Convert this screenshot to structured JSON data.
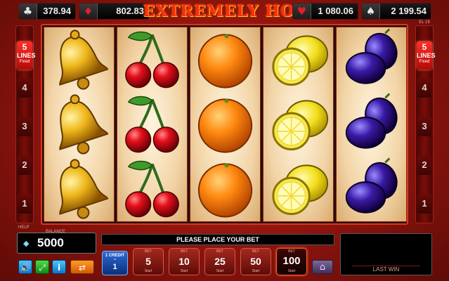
{
  "title": "EXTREMELY HOT",
  "jackpots": [
    {
      "suit_icon": "clubs-icon",
      "glyph": "♣",
      "color": "#e8e8e8",
      "amount": "378.94"
    },
    {
      "suit_icon": "diamonds-icon",
      "glyph": "♦",
      "color": "#e0202a",
      "amount": "802.83"
    },
    {
      "suit_icon": "hearts-icon",
      "glyph": "♥",
      "color": "#e0202a",
      "amount": "1 080.06"
    },
    {
      "suit_icon": "spades-icon",
      "glyph": "♠",
      "color": "#e8e8e8",
      "amount": "2 199.54"
    }
  ],
  "lines_panel": {
    "count": "5",
    "label": "LINES",
    "sub": "Fixed",
    "numbers": [
      "4",
      "3",
      "2",
      "1"
    ],
    "left_tiny": "",
    "right_tiny": "EL 19"
  },
  "reels": [
    [
      "bell",
      "bell",
      "bell"
    ],
    [
      "cherry",
      "cherry",
      "cherry"
    ],
    [
      "orange",
      "orange",
      "orange"
    ],
    [
      "lemon",
      "lemon",
      "lemon"
    ],
    [
      "plum",
      "plum",
      "plum"
    ]
  ],
  "help_label": "HELP",
  "balance_label": "BALANCE",
  "balance": "5000",
  "message": "PLEASE PLACE YOUR BET",
  "credit": {
    "label": "1 CREDIT",
    "symbol": "=",
    "value": "1"
  },
  "bet_top_label": "BET",
  "bet_bottom_label": "Start",
  "bets": [
    "5",
    "10",
    "25",
    "50",
    "100"
  ],
  "active_bet": "100",
  "last_win_label": "LAST WIN",
  "toolbar": [
    {
      "name": "sound-icon",
      "glyph": "🔊"
    },
    {
      "name": "fullscreen-icon",
      "glyph": "⤢"
    },
    {
      "name": "info-icon",
      "glyph": "i"
    },
    {
      "name": "autoplay-icon",
      "glyph": "⇄"
    }
  ],
  "home_glyph": "⌂",
  "colors": {
    "accent_red": "#d23a22",
    "background": "#8d140e",
    "title": "#ff2a12"
  }
}
